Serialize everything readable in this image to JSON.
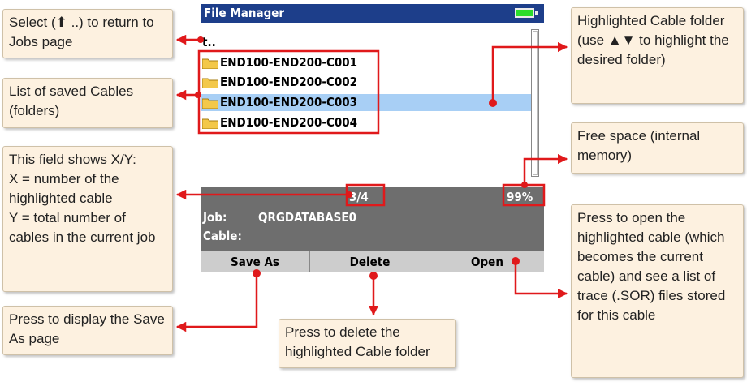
{
  "device": {
    "title": "File Manager",
    "battery_icon": "battery-full-icon",
    "up_entry": "t..",
    "cables": [
      {
        "label": "END100-END200-C001",
        "highlighted": false
      },
      {
        "label": "END100-END200-C002",
        "highlighted": false
      },
      {
        "label": "END100-END200-C003",
        "highlighted": true
      },
      {
        "label": "END100-END200-C004",
        "highlighted": false
      }
    ],
    "counter": "3/4",
    "free_space": "99%",
    "job_label": "Job:",
    "job_value": "QRGDATABASE0",
    "cable_label": "Cable:",
    "buttons": {
      "save_as": "Save As",
      "delete": "Delete",
      "open": "Open"
    }
  },
  "callouts": {
    "select_up": "Select  (⬆ ..) to return to Jobs page",
    "list_saved": "List of saved Cables (folders)",
    "xy_field": "This field shows X/Y:\nX = number of the highlighted cable\nY = total number of cables in the current job",
    "save_as": "Press to display the Save As page",
    "delete": "Press to delete the highlighted Cable folder",
    "highlighted": "Highlighted Cable folder (use ▲▼ to highlight the desired folder)",
    "free_space": "Free space (internal memory)",
    "open": "Press to open the highlighted cable (which becomes the current cable) and see a list of trace (.SOR) files stored for this cable"
  },
  "colors": {
    "title_bar": "#1d3e8a",
    "highlight": "#a8cff5",
    "status_bar": "#6e6e6e",
    "arrows": "#e0191b",
    "callout_bg": "#fdf1e0"
  }
}
